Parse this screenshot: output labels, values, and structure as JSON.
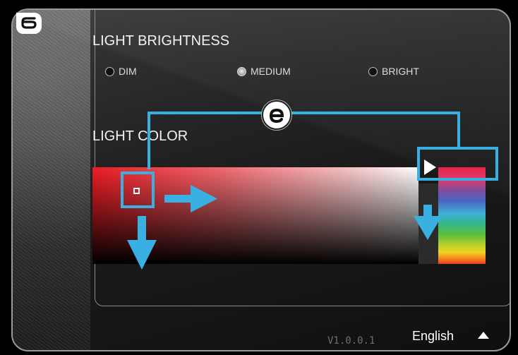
{
  "brightness": {
    "title": "LIGHT BRIGHTNESS",
    "options": [
      {
        "label": "DIM",
        "checked": false
      },
      {
        "label": "MEDIUM",
        "checked": true
      },
      {
        "label": "BRIGHT",
        "checked": false
      }
    ]
  },
  "color": {
    "title": "LIGHT COLOR",
    "selected_hue": "red",
    "colors": {
      "accent_callout": "#3ab0e2",
      "base_red": "#ed1c24"
    }
  },
  "footer": {
    "version": "V1.0.0.1",
    "language": "English"
  },
  "annotations": {
    "markers": [
      "6",
      "e"
    ],
    "icons": [
      "arrow-right-icon",
      "arrow-down-icon",
      "triangle-up-icon",
      "play-icon"
    ]
  }
}
